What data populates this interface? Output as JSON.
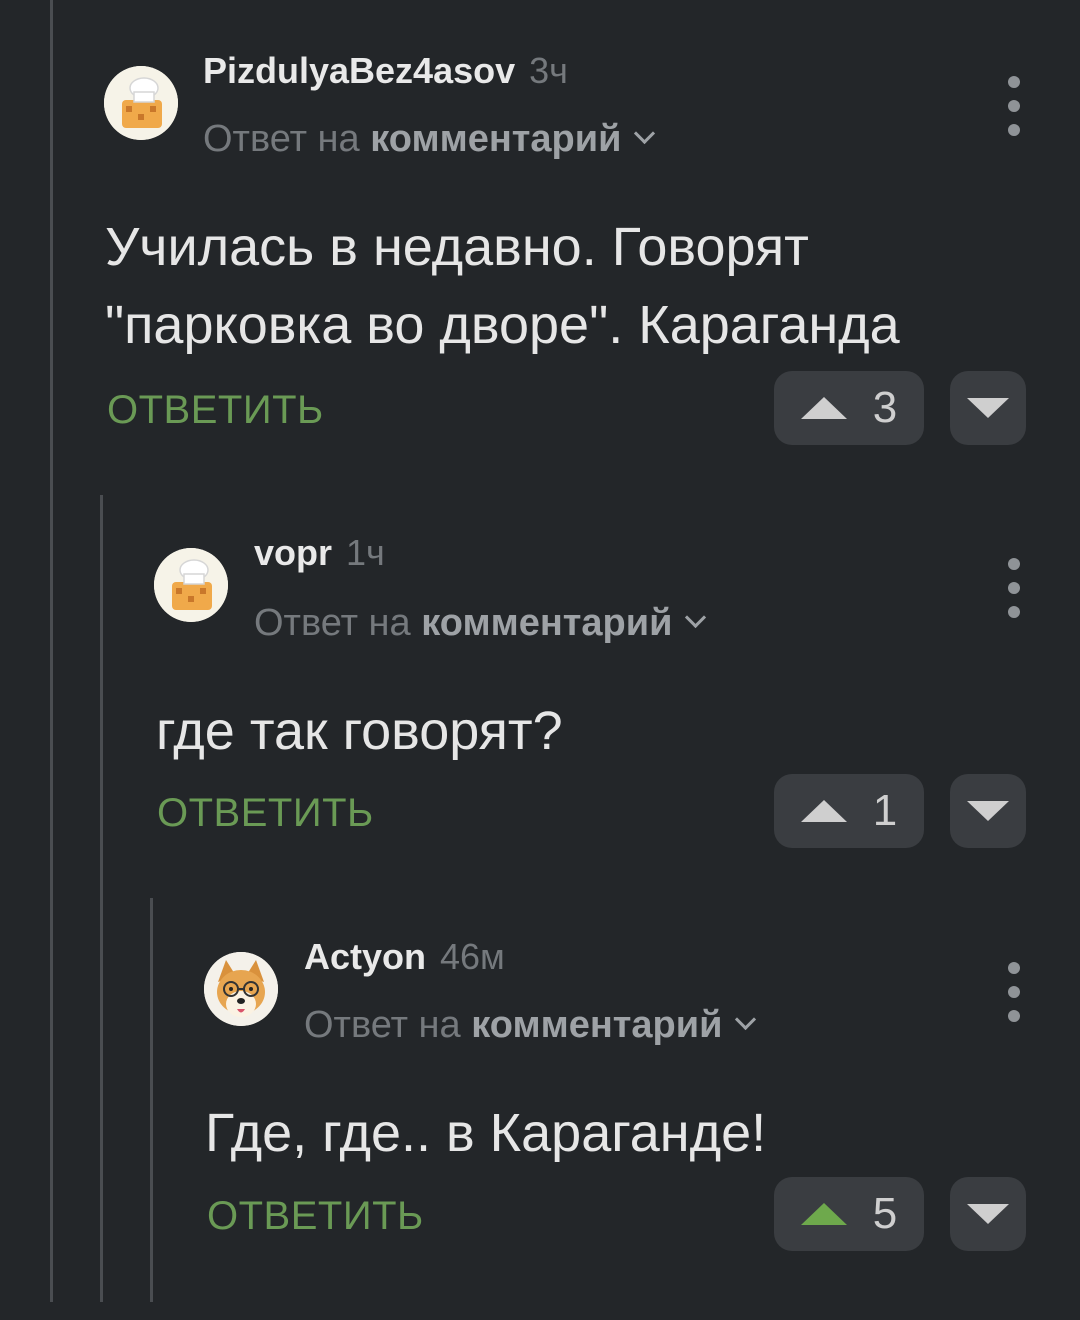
{
  "comments": [
    {
      "author": "PizdulyaBez4asov",
      "time": "3ч",
      "avatar_icon": "chef-hat-avatar-icon",
      "reply_prefix": "Ответ на",
      "reply_target": "комментарий",
      "text_lines": [
        "Училась в недавно. Говорят",
        "\"парковка во дворе\". Караганда"
      ],
      "reply_label": "ОТВЕТИТЬ",
      "score": "3",
      "upvoted": false
    },
    {
      "author": "vopr",
      "time": "1ч",
      "avatar_icon": "chef-hat-avatar-icon",
      "reply_prefix": "Ответ на",
      "reply_target": "комментарий",
      "text_lines": [
        "где так говорят?"
      ],
      "reply_label": "ОТВЕТИТЬ",
      "score": "1",
      "upvoted": false
    },
    {
      "author": "Actyon",
      "time": "46м",
      "avatar_icon": "shiba-dog-avatar-icon",
      "reply_prefix": "Ответ на",
      "reply_target": "комментарий",
      "text_lines": [
        "Где, где.. в Караганде!"
      ],
      "reply_label": "ОТВЕТИТЬ",
      "score": "5",
      "upvoted": true
    }
  ],
  "colors": {
    "background": "#232629",
    "reply_green": "#6a9a55",
    "upvote_active": "#6ea94c",
    "muted_text": "#75797d"
  }
}
